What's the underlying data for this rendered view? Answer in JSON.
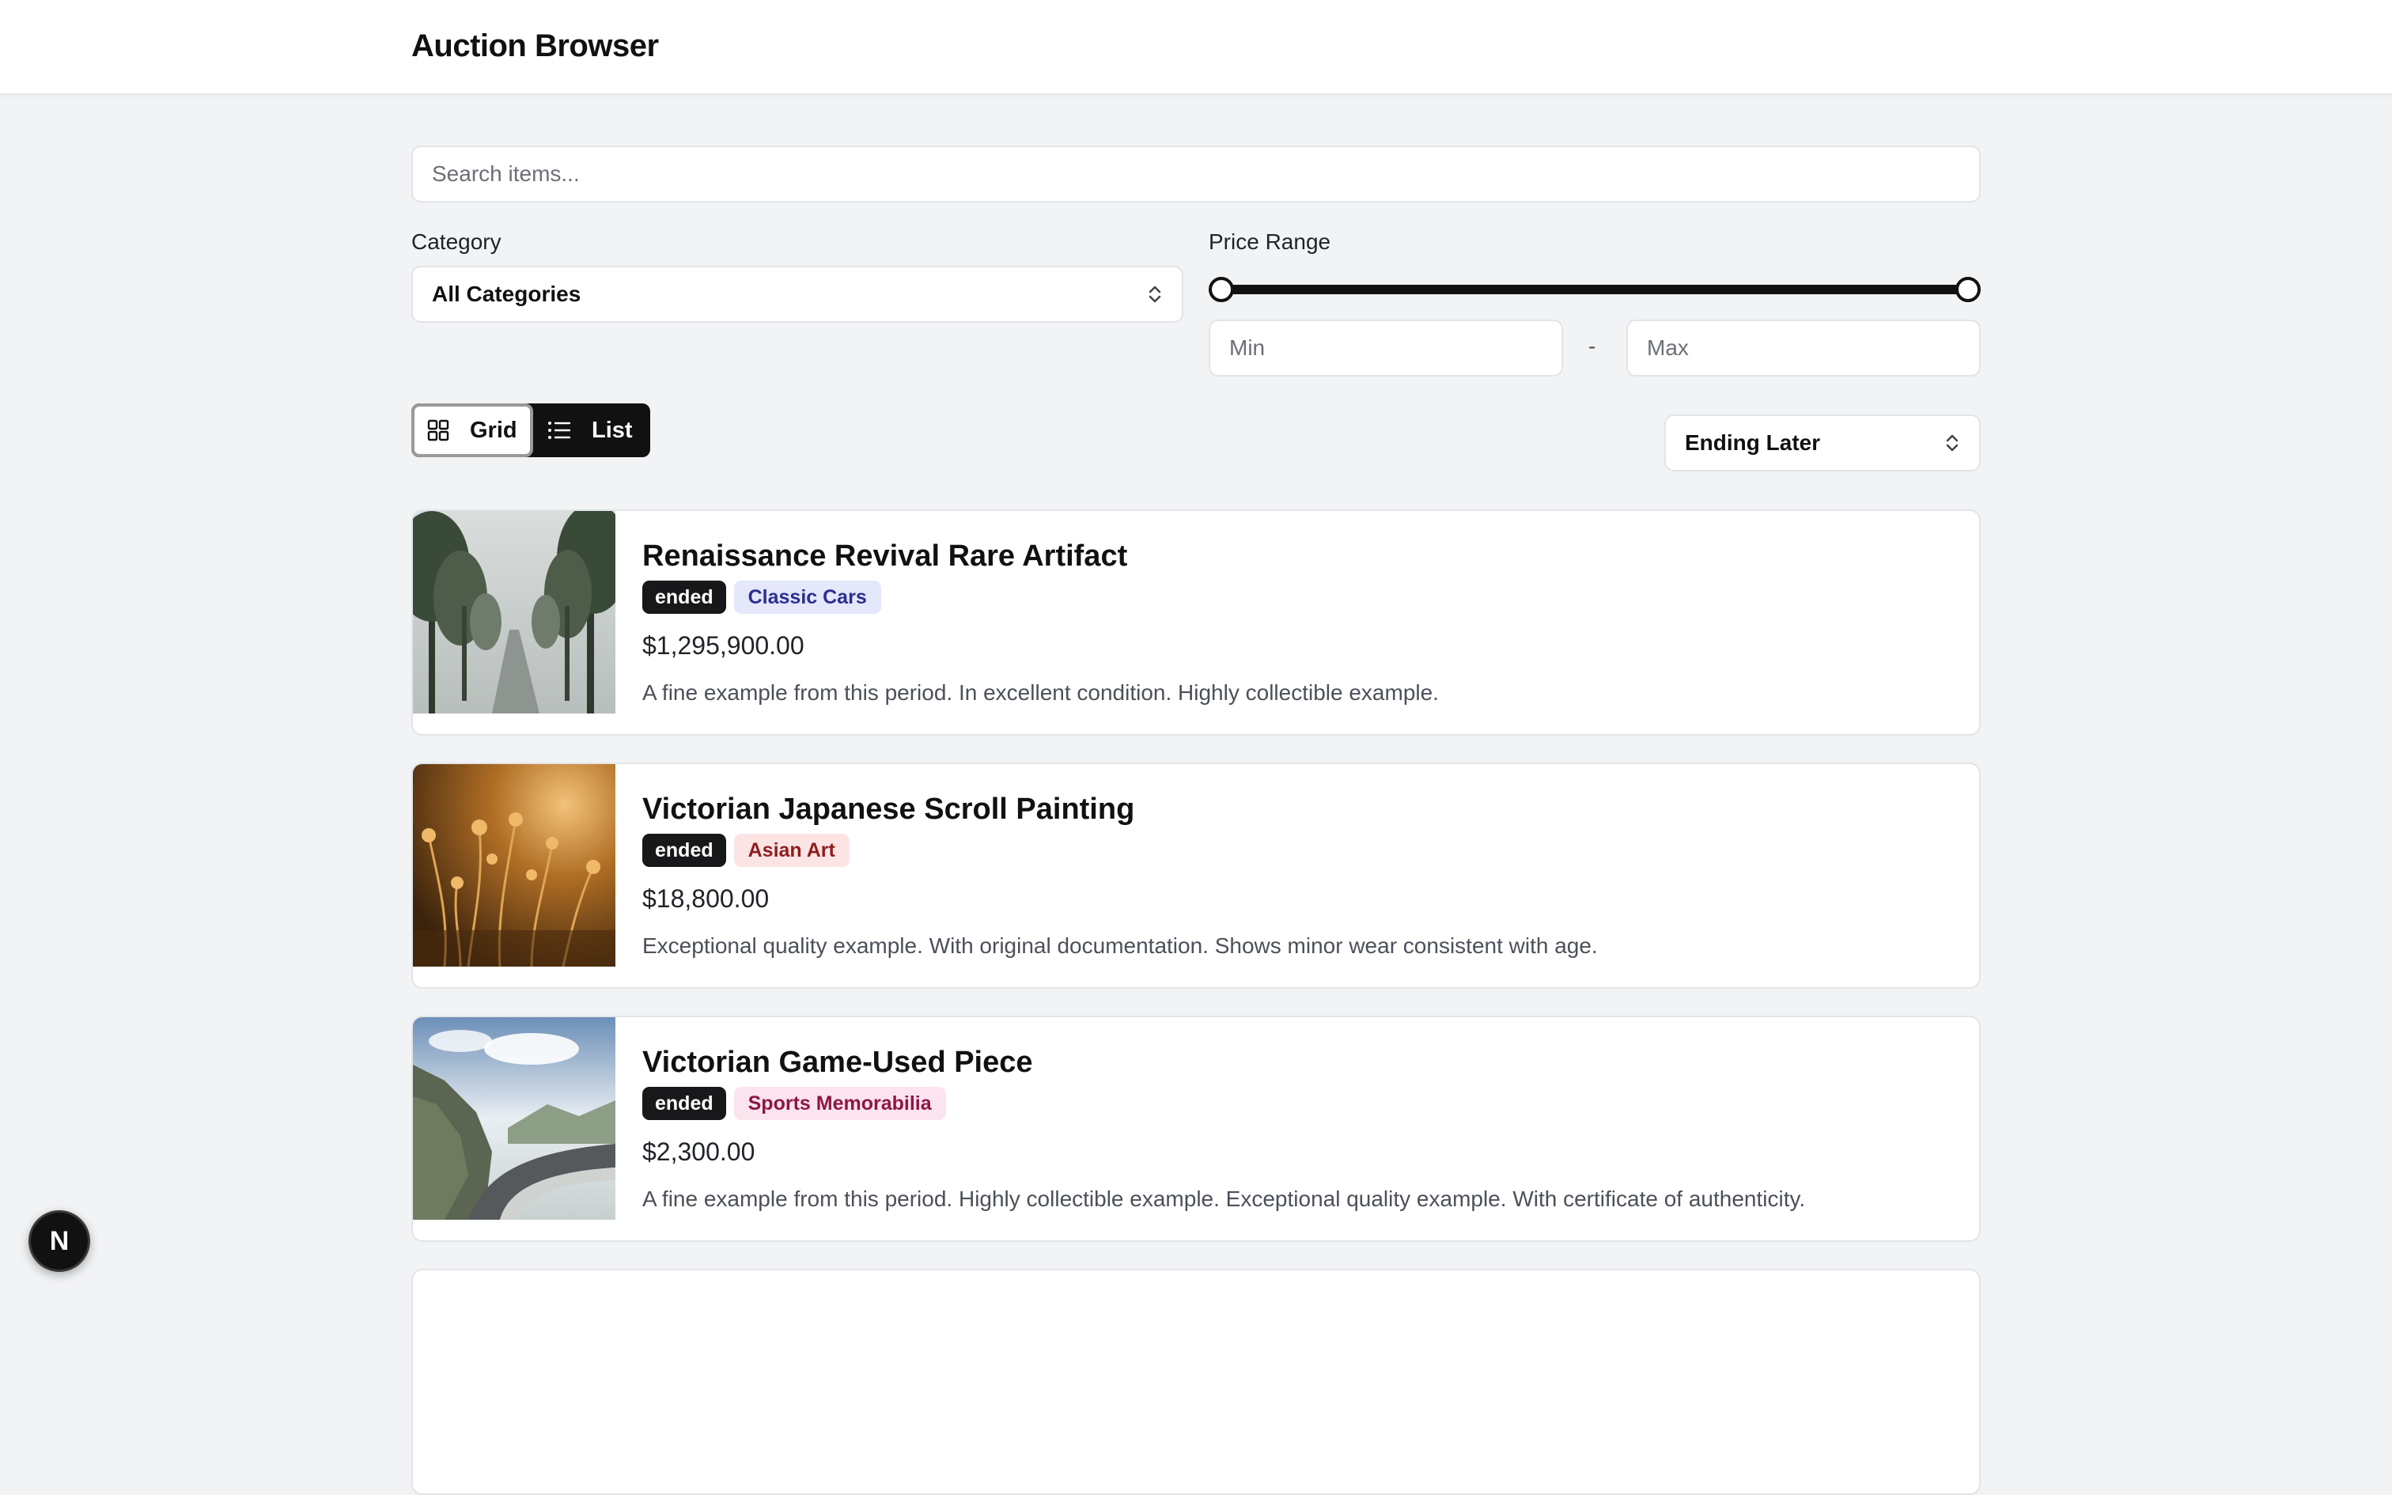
{
  "app": {
    "title": "Auction Browser"
  },
  "search": {
    "placeholder": "Search items..."
  },
  "filters": {
    "category_label": "Category",
    "category_value": "All Categories",
    "price_label": "Price Range",
    "price_range": {
      "low": 0,
      "high": 1
    },
    "min_placeholder": "Min",
    "max_placeholder": "Max",
    "separator": "-"
  },
  "view": {
    "grid_label": "Grid",
    "list_label": "List",
    "selected": "Grid"
  },
  "sort": {
    "value": "Ending Later"
  },
  "items": [
    {
      "title": "Renaissance Revival Rare Artifact",
      "status": "ended",
      "category": "Classic Cars",
      "category_bg": "#e5e7fb",
      "category_fg": "#2b2f8f",
      "price": "$1,295,900.00",
      "description": "A fine example from this period. In excellent condition. Highly collectible example.",
      "image": "misty-tree-road"
    },
    {
      "title": "Victorian Japanese Scroll Painting",
      "status": "ended",
      "category": "Asian Art",
      "category_bg": "#fde4e4",
      "category_fg": "#8f1d1d",
      "price": "$18,800.00",
      "description": "Exceptional quality example. With original documentation. Shows minor wear consistent with age.",
      "image": "golden-grass"
    },
    {
      "title": "Victorian Game-Used Piece",
      "status": "ended",
      "category": "Sports Memorabilia",
      "category_bg": "#fce4ef",
      "category_fg": "#8d1746",
      "price": "$2,300.00",
      "description": "A fine example from this period. Highly collectible example. Exceptional quality example. With certificate of authenticity.",
      "image": "mountain-road"
    }
  ],
  "fab": {
    "label": "N"
  }
}
